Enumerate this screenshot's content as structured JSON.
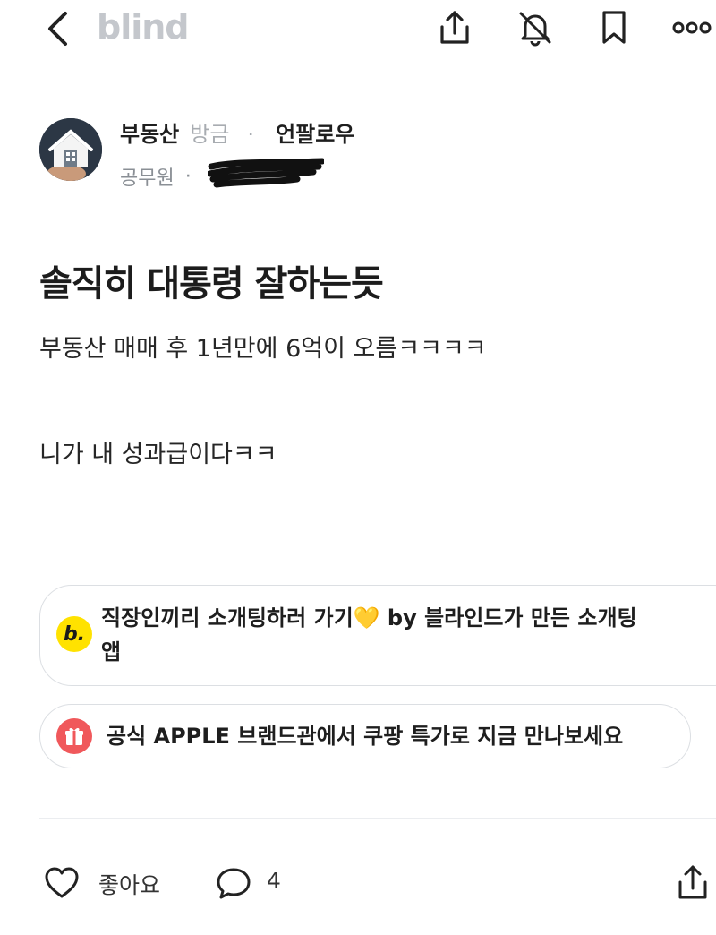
{
  "header": {
    "logo": "blind",
    "icons": [
      "back-arrow-icon",
      "share-icon",
      "bell-off-icon",
      "bookmark-icon",
      "more-icon"
    ]
  },
  "author": {
    "board": "부동산",
    "time": "방금",
    "separator": "·",
    "nickname": "언팔로우",
    "company": "공무원",
    "company_separator": "·"
  },
  "post": {
    "title": "솔직히 대통령 잘하는듯",
    "body": [
      "부동산 매매 후 1년만에 6억이 오름ㅋㅋㅋㅋ",
      "니가 내 성과급이다ㅋㅋ"
    ]
  },
  "promos": [
    {
      "icon_text": "b.",
      "text": "직장인끼리 소개팅하러 가기💛 by 블라인드가 만든 소개팅앱"
    },
    {
      "icon": "gift-icon",
      "text": "공식 APPLE 브랜드관에서 쿠팡 특가로 지금 만나보세요"
    }
  ],
  "actions": {
    "like_label": "좋아요",
    "comment_count": "4"
  },
  "colors": {
    "logo": "#c4c7cc",
    "muted": "#a8acb1",
    "promo_yellow": "#ffe200",
    "promo_red": "#f0585b",
    "border": "#dcdfe3"
  }
}
